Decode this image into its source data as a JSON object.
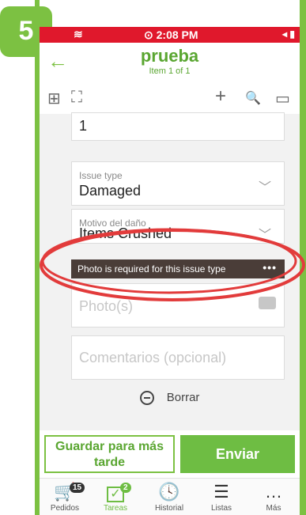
{
  "step_badge": "5",
  "status": {
    "time": "⊙ 2:08 PM",
    "right_icons": "◂ ▮"
  },
  "header": {
    "back_icon": "←",
    "title": "prueba",
    "subtitle": "Item 1 of 1"
  },
  "toolbar": {
    "scan_icon": "⊞",
    "expand_icon": "⛶",
    "add_icon": "+",
    "search_icon": "🔍",
    "book_icon": "▭"
  },
  "form": {
    "quantity_value": "1",
    "issue_type_label": "Issue type",
    "issue_type_value": "Damaged",
    "damage_reason_label": "Motivo del daño",
    "damage_reason_value": "Items Crushed",
    "tooltip_text": "Photo is required for this issue type",
    "tooltip_dots": "•••",
    "photo_placeholder": "Photo(s)",
    "comments_placeholder": "Comentarios (opcional)",
    "delete_label": "Borrar"
  },
  "actions": {
    "save_later_label": "Guardar para más tarde",
    "send_label": "Enviar"
  },
  "tabbar": {
    "items": [
      {
        "label": "Pedidos",
        "badge": "15"
      },
      {
        "label": "Tareas",
        "badge": "2"
      },
      {
        "label": "Historial"
      },
      {
        "label": "Listas"
      },
      {
        "label": "Más"
      }
    ]
  },
  "colors": {
    "brand_green": "#7cc142",
    "statusbar_red": "#e0182c",
    "annotation_red": "#e23b3b"
  }
}
